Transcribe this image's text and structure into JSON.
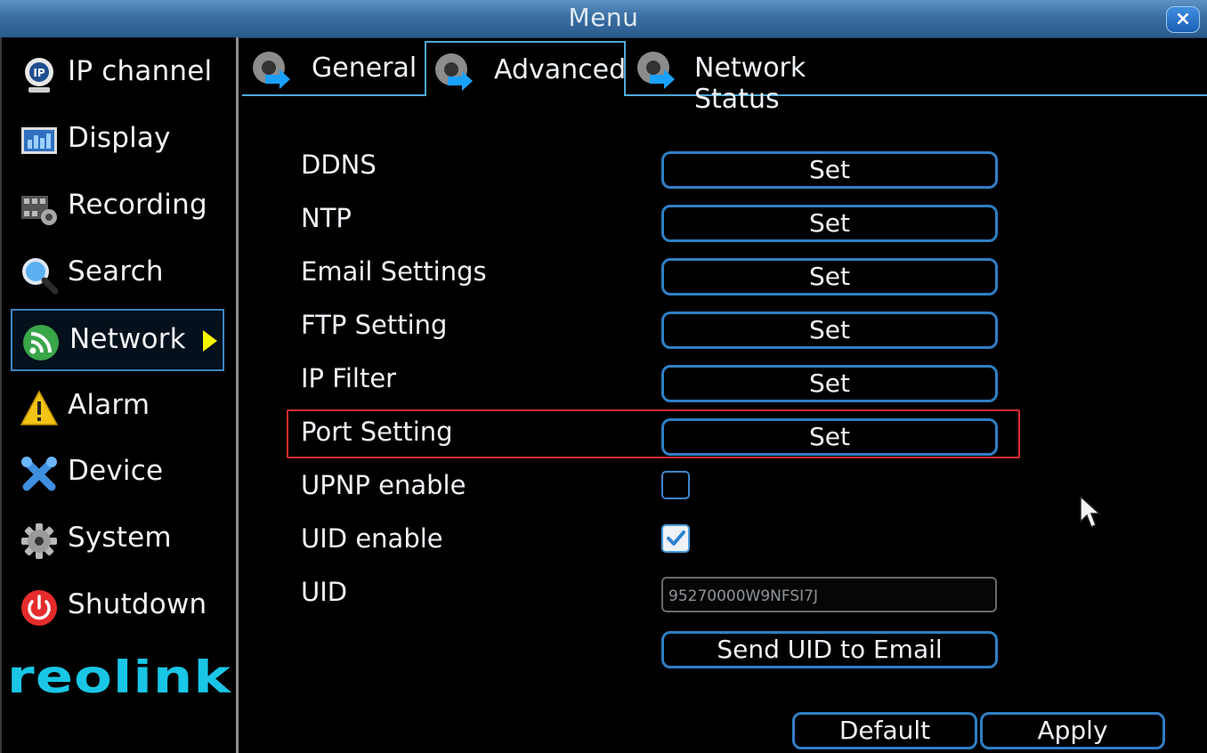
{
  "window": {
    "title": "Menu",
    "close_icon": "×"
  },
  "sidebar": {
    "items": [
      {
        "label": "IP channel",
        "icon": "ip-camera-icon"
      },
      {
        "label": "Display",
        "icon": "display-icon"
      },
      {
        "label": "Recording",
        "icon": "recording-icon"
      },
      {
        "label": "Search",
        "icon": "search-icon"
      },
      {
        "label": "Network",
        "icon": "network-icon",
        "active": true
      },
      {
        "label": "Alarm",
        "icon": "alarm-icon"
      },
      {
        "label": "Device",
        "icon": "device-icon"
      },
      {
        "label": "System",
        "icon": "system-icon"
      },
      {
        "label": "Shutdown",
        "icon": "shutdown-icon"
      }
    ],
    "logo_text": "reolink"
  },
  "tabs": [
    {
      "label": "General",
      "active": false
    },
    {
      "label": "Advanced",
      "active": true
    },
    {
      "label": "Network Status",
      "active": false
    }
  ],
  "settings": {
    "rows": [
      {
        "label": "DDNS",
        "button": "Set"
      },
      {
        "label": "NTP",
        "button": "Set"
      },
      {
        "label": "Email Settings",
        "button": "Set"
      },
      {
        "label": "FTP Setting",
        "button": "Set"
      },
      {
        "label": "IP Filter",
        "button": "Set"
      },
      {
        "label": "Port Setting",
        "button": "Set"
      }
    ],
    "upnp": {
      "label": "UPNP enable",
      "checked": false
    },
    "uid_enable": {
      "label": "UID enable",
      "checked": true
    },
    "uid": {
      "label": "UID",
      "value": "95270000W9NFSI7J"
    },
    "send_uid_button": "Send UID to Email"
  },
  "footer": {
    "default_button": "Default",
    "apply_button": "Apply"
  },
  "colors": {
    "accent": "#2f7fc4",
    "highlight": "#e32b2b",
    "titlebar": "#3a6fa3"
  }
}
